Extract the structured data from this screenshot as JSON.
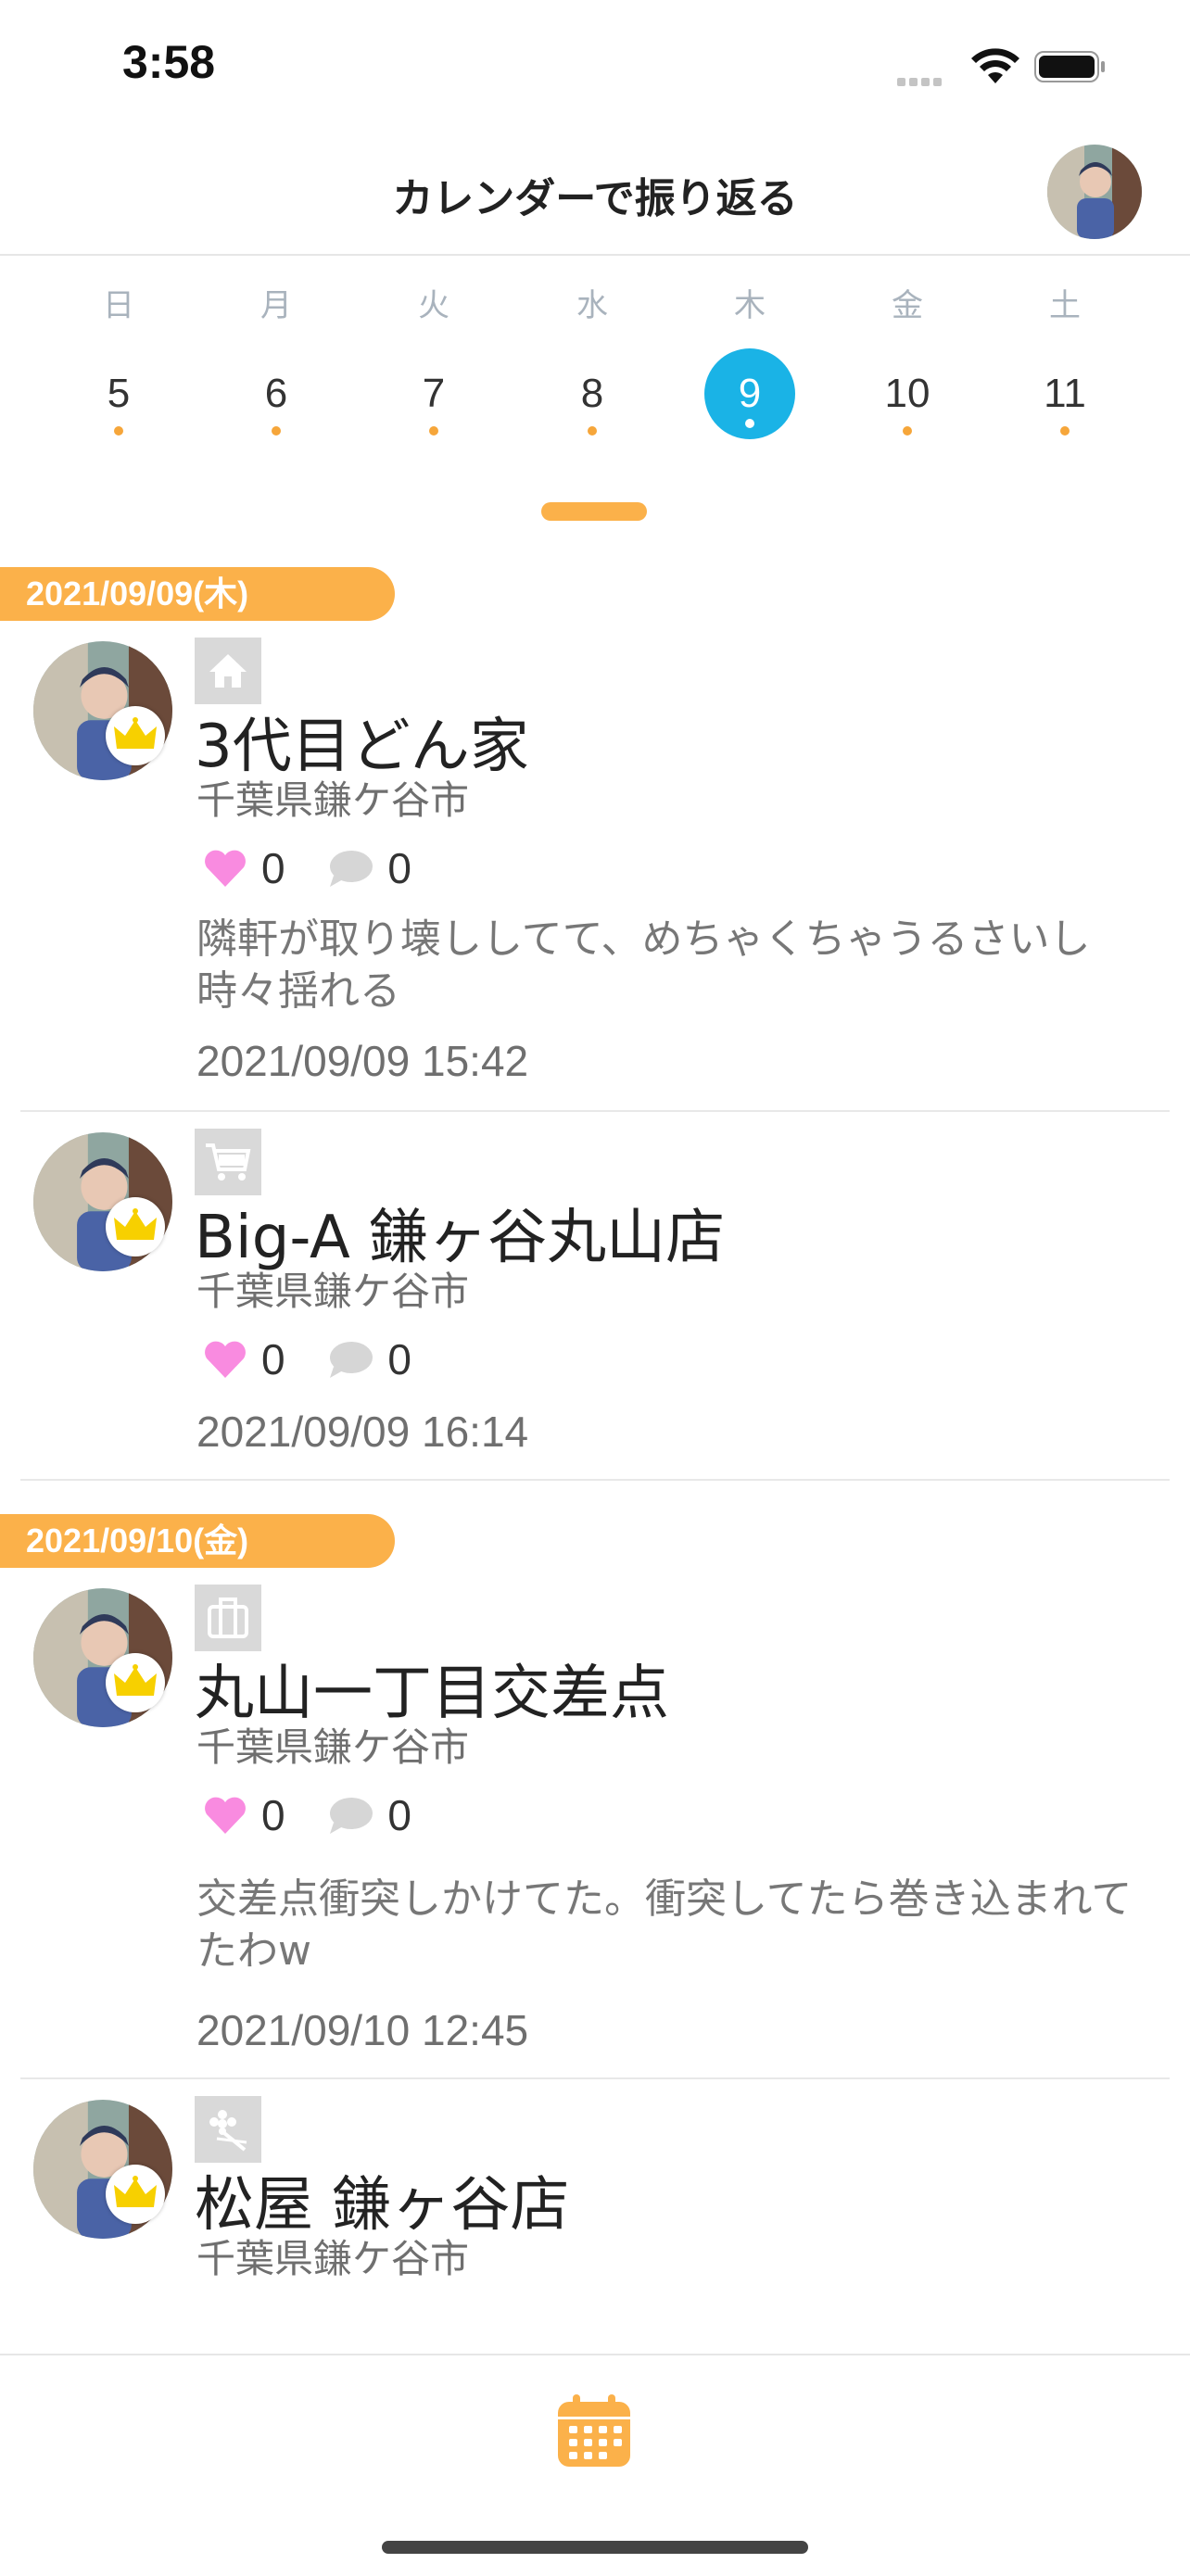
{
  "status_bar": {
    "time": "3:58"
  },
  "header": {
    "title": "カレンダーで振り返る"
  },
  "week": {
    "days": [
      {
        "dow": "日",
        "num": "5",
        "selected": false
      },
      {
        "dow": "月",
        "num": "6",
        "selected": false
      },
      {
        "dow": "火",
        "num": "7",
        "selected": false
      },
      {
        "dow": "水",
        "num": "8",
        "selected": false
      },
      {
        "dow": "木",
        "num": "9",
        "selected": true
      },
      {
        "dow": "金",
        "num": "10",
        "selected": false
      },
      {
        "dow": "土",
        "num": "11",
        "selected": false
      }
    ]
  },
  "feed": {
    "groups": [
      {
        "date": "2021/09/09(木)",
        "posts": [
          {
            "category_icon": "home-icon",
            "title": "3代目どん家",
            "place": "千葉県鎌ケ谷市",
            "likes": "0",
            "comments": "0",
            "body": "隣軒が取り壊ししてて、めちゃくちゃうるさいし時々揺れる",
            "time": "2021/09/09 15:42"
          },
          {
            "category_icon": "shopping-cart-icon",
            "title": "Big-A 鎌ヶ谷丸山店",
            "place": "千葉県鎌ケ谷市",
            "likes": "0",
            "comments": "0",
            "body": "",
            "time": "2021/09/09 16:14"
          }
        ]
      },
      {
        "date": "2021/09/10(金)",
        "posts": [
          {
            "category_icon": "suitcase-icon",
            "title": "丸山一丁目交差点",
            "place": "千葉県鎌ケ谷市",
            "likes": "0",
            "comments": "0",
            "body": "交差点衝突しかけてた。衝突してたら巻き込まれてたわw",
            "time": "2021/09/10 12:45"
          },
          {
            "category_icon": "flower-icon",
            "title": "松屋 鎌ヶ谷店",
            "place": "千葉県鎌ケ谷市"
          }
        ]
      }
    ]
  },
  "colors": {
    "accent": "#fbb14a",
    "selected_day": "#1ab3e6",
    "heart": "#f98be0",
    "bubble": "#d6d6d6"
  },
  "tabbar": {
    "icon": "calendar-icon"
  }
}
